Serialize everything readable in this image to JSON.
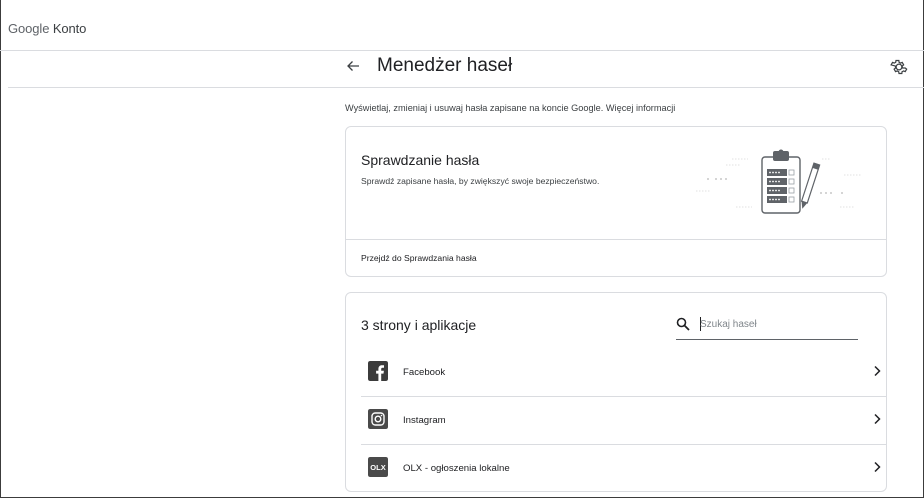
{
  "app": {
    "logo_google": "Google",
    "logo_konto": "Konto"
  },
  "header": {
    "title": "Menedżer haseł"
  },
  "intro": {
    "text": "Wyświetlaj, zmieniaj i usuwaj hasła zapisane na koncie Google. Więcej informacji"
  },
  "checkup": {
    "title": "Sprawdzanie hasła",
    "subtitle": "Sprawdź zapisane hasła, by zwiększyć swoje bezpieczeństwo.",
    "link": "Przejdź do Sprawdzania hasła",
    "illustration_rows": [
      "••••",
      "••••",
      "••••",
      "••••"
    ]
  },
  "passwords": {
    "title": "3 strony i aplikacje",
    "search_placeholder": "Szukaj haseł",
    "items": [
      {
        "label": "Facebook",
        "icon": "facebook-icon"
      },
      {
        "label": "Instagram",
        "icon": "instagram-icon"
      },
      {
        "label": "OLX - ogłoszenia lokalne",
        "icon": "olx-icon",
        "icon_text": "OLX"
      }
    ]
  },
  "colors": {
    "text_primary": "#202124",
    "text_secondary": "#3c4043",
    "divider": "#dadce0"
  }
}
